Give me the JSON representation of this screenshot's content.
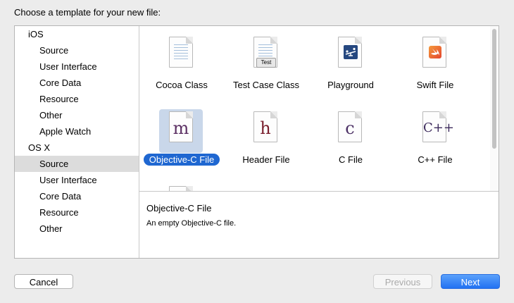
{
  "dialog": {
    "title": "Choose a template for your new file:"
  },
  "sidebar": {
    "groups": [
      {
        "label": "iOS",
        "items": [
          "Source",
          "User Interface",
          "Core Data",
          "Resource",
          "Other",
          "Apple Watch"
        ]
      },
      {
        "label": "OS X",
        "items": [
          "Source",
          "User Interface",
          "Core Data",
          "Resource",
          "Other"
        ]
      }
    ],
    "selected": "OS X / Source"
  },
  "templates": [
    {
      "label": "Cocoa Class",
      "icon": "cocoa-class-icon",
      "glyph": ""
    },
    {
      "label": "Test Case Class",
      "icon": "test-case-class-icon",
      "glyph": "",
      "badge": "Test"
    },
    {
      "label": "Playground",
      "icon": "playground-icon",
      "glyph": ""
    },
    {
      "label": "Swift File",
      "icon": "swift-icon",
      "glyph": ""
    },
    {
      "label": "Objective-C File",
      "icon": "objective-c-file-icon",
      "glyph": "m",
      "selected": true
    },
    {
      "label": "Header File",
      "icon": "header-file-icon",
      "glyph": "h"
    },
    {
      "label": "C File",
      "icon": "c-file-icon",
      "glyph": "c"
    },
    {
      "label": "C++ File",
      "icon": "cpp-file-icon",
      "glyph": "C++"
    }
  ],
  "description": {
    "title": "Objective-C File",
    "text": "An empty Objective-C file."
  },
  "buttons": {
    "cancel": "Cancel",
    "previous": "Previous",
    "next": "Next"
  },
  "colors": {
    "accent": "#1f67d1",
    "selection_bg": "#c9d7ea",
    "sidebar_selected": "#dcdcdc",
    "glyph": "#5a2e62",
    "header_glyph": "#7a1f2d"
  }
}
